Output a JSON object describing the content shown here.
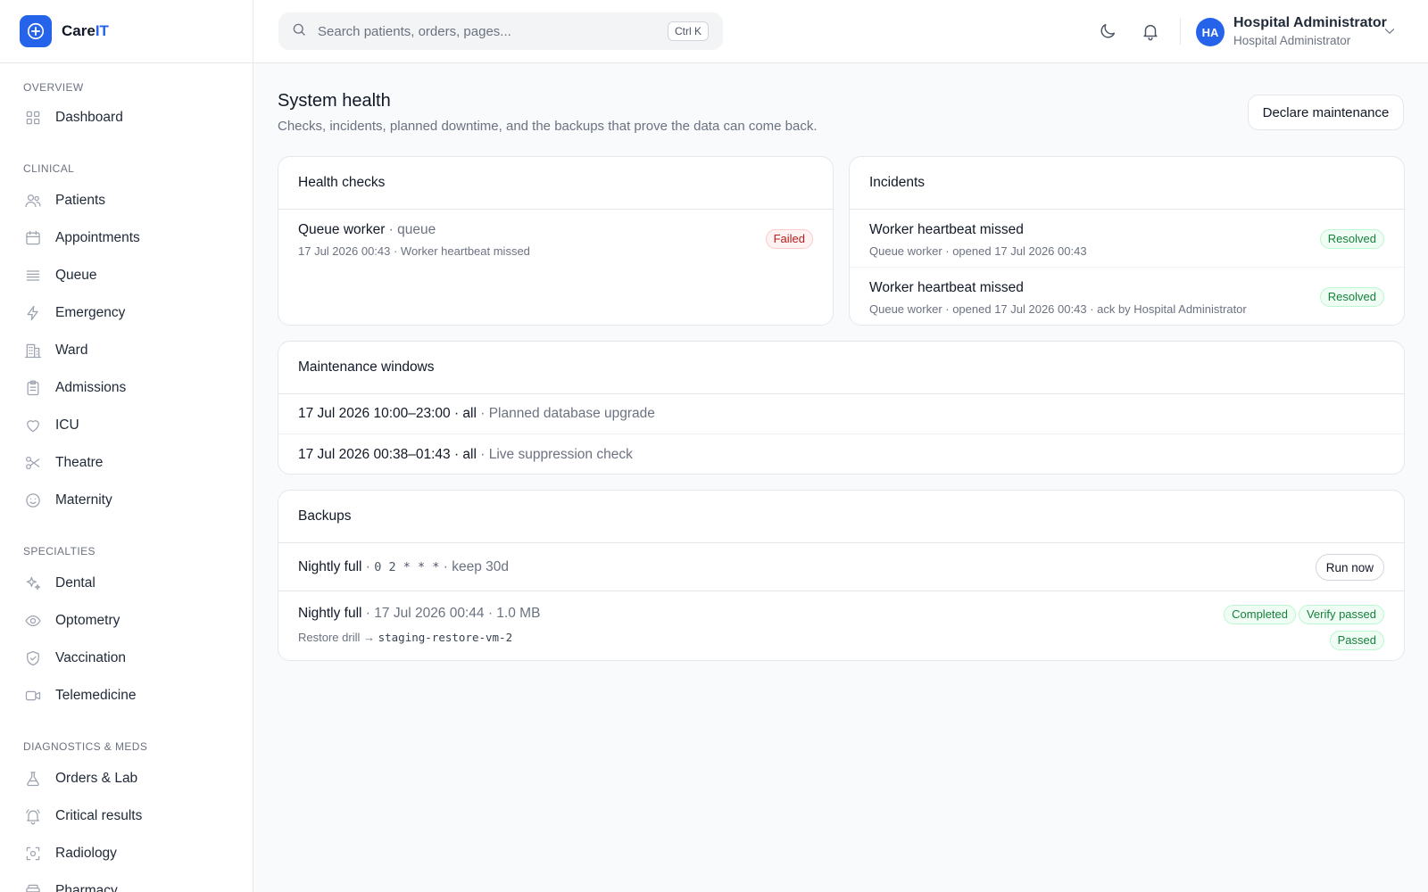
{
  "brand": {
    "name_prefix": "Care",
    "name_suffix": "IT"
  },
  "sidebar": {
    "sections": [
      {
        "title": "Overview",
        "items": [
          {
            "label": "Dashboard",
            "icon": "grid-icon"
          }
        ]
      },
      {
        "title": "Clinical",
        "items": [
          {
            "label": "Patients",
            "icon": "users-icon"
          },
          {
            "label": "Appointments",
            "icon": "calendar-icon"
          },
          {
            "label": "Queue",
            "icon": "list-icon"
          },
          {
            "label": "Emergency",
            "icon": "bolt-icon"
          },
          {
            "label": "Ward",
            "icon": "building-icon"
          },
          {
            "label": "Admissions",
            "icon": "clipboard-icon"
          },
          {
            "label": "ICU",
            "icon": "heart-icon"
          },
          {
            "label": "Theatre",
            "icon": "scissors-icon"
          },
          {
            "label": "Maternity",
            "icon": "smile-icon"
          }
        ]
      },
      {
        "title": "Specialties",
        "items": [
          {
            "label": "Dental",
            "icon": "sparkles-icon"
          },
          {
            "label": "Optometry",
            "icon": "eye-icon"
          },
          {
            "label": "Vaccination",
            "icon": "shield-icon"
          },
          {
            "label": "Telemedicine",
            "icon": "video-icon"
          }
        ]
      },
      {
        "title": "Diagnostics & Meds",
        "items": [
          {
            "label": "Orders & Lab",
            "icon": "flask-icon"
          },
          {
            "label": "Critical results",
            "icon": "bell-alert-icon"
          },
          {
            "label": "Radiology",
            "icon": "scan-icon"
          },
          {
            "label": "Pharmacy",
            "icon": "box-icon"
          }
        ]
      }
    ]
  },
  "header": {
    "search_placeholder": "Search patients, orders, pages...",
    "shortcut": "Ctrl K",
    "user": {
      "initials": "HA",
      "name": "Hospital Administrator",
      "role": "Hospital Administrator"
    }
  },
  "page": {
    "title": "System health",
    "subtitle": "Checks, incidents, planned downtime, and the backups that prove the data can come back.",
    "declare_button": "Declare maintenance"
  },
  "health_checks": {
    "title": "Health checks",
    "items": [
      {
        "name": "Queue worker",
        "type": "queue",
        "detail": "17 Jul 2026 00:43 · Worker heartbeat missed",
        "status": "Failed"
      }
    ]
  },
  "incidents": {
    "title": "Incidents",
    "items": [
      {
        "title": "Worker heartbeat missed",
        "detail": "Queue worker · opened 17 Jul 2026 00:43",
        "status": "Resolved"
      },
      {
        "title": "Worker heartbeat missed",
        "detail": "Queue worker · opened 17 Jul 2026 00:43 · ack by Hospital Administrator",
        "status": "Resolved"
      }
    ]
  },
  "maintenance": {
    "title": "Maintenance windows",
    "items": [
      {
        "window": "17 Jul 2026 10:00–23:00 · all",
        "reason": "Planned database upgrade"
      },
      {
        "window": "17 Jul 2026 00:38–01:43 · all",
        "reason": "Live suppression check"
      }
    ]
  },
  "backups": {
    "title": "Backups",
    "schedule": {
      "name": "Nightly full",
      "cron": "0 2 * * *",
      "retention": "keep 30d",
      "run_button": "Run now"
    },
    "last_run": {
      "name": "Nightly full",
      "detail": "17 Jul 2026 00:44 · 1.0 MB",
      "status": "Completed",
      "verify": "Verify passed",
      "drill_label": "Restore drill →",
      "drill_target": "staging-restore-vm-2",
      "drill_status": "Passed"
    }
  },
  "colors": {
    "accent": "#2563eb",
    "danger": "#b91c1c",
    "success": "#15803d"
  }
}
